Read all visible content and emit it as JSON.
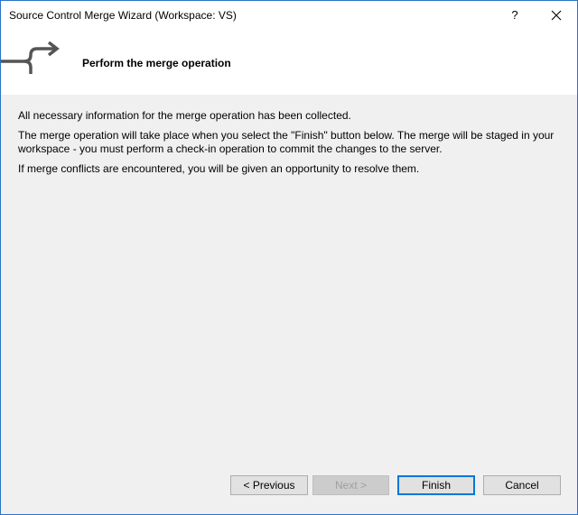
{
  "window": {
    "title": "Source Control Merge Wizard (Workspace: VS)",
    "help_label": "?",
    "close_icon": "close-icon"
  },
  "header": {
    "title": "Perform the merge operation",
    "icon": "merge-arrow-icon"
  },
  "content": {
    "paragraphs": [
      "All necessary information for the merge operation has been collected.",
      "The merge operation will take place when you select the \"Finish\" button below. The merge will be staged in your workspace - you must perform a check-in operation to commit the changes to the server.",
      "If merge conflicts are encountered, you will be given an opportunity to resolve them."
    ]
  },
  "buttons": {
    "previous": "< Previous",
    "next": "Next >",
    "finish": "Finish",
    "cancel": "Cancel"
  },
  "colors": {
    "window_border": "#2b73c8",
    "focus_border": "#0078d7",
    "dialog_background": "#f0f0f0"
  }
}
